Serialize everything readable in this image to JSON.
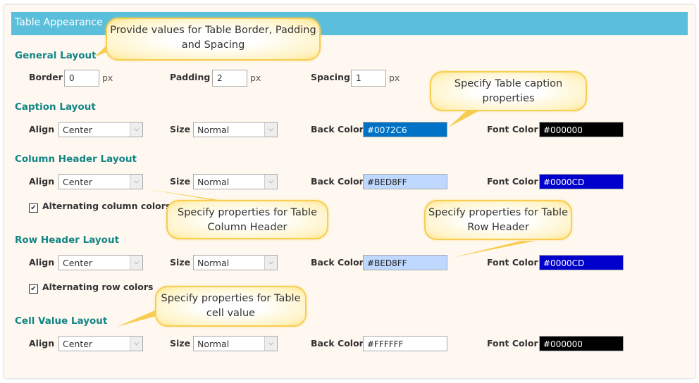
{
  "title": "Table Appearance",
  "general": {
    "heading": "General Layout",
    "border_label": "Border",
    "border_value": "0",
    "padding_label": "Padding",
    "padding_value": "2",
    "spacing_label": "Spacing",
    "spacing_value": "1",
    "unit": "px"
  },
  "labels": {
    "align": "Align",
    "size": "Size",
    "back_color": "Back Color",
    "font_color": "Font Color"
  },
  "caption": {
    "heading": "Caption Layout",
    "align": "Center",
    "size": "Normal",
    "back_color": "#0072C6",
    "font_color": "#000000"
  },
  "column_header": {
    "heading": "Column Header Layout",
    "align": "Center",
    "size": "Normal",
    "back_color": "#BED8FF",
    "font_color": "#0000CD",
    "alternating_label": "Alternating column colors",
    "alternating_checked": true
  },
  "row_header": {
    "heading": "Row Header Layout",
    "align": "Center",
    "size": "Normal",
    "back_color": "#BED8FF",
    "font_color": "#0000CD",
    "alternating_label": "Alternating row colors",
    "alternating_checked": true
  },
  "cell_value": {
    "heading": "Cell Value Layout",
    "align": "Center",
    "size": "Normal",
    "back_color": "#FFFFFF",
    "font_color": "#000000"
  },
  "callouts": {
    "general": "Provide values for Table Border, Padding and Spacing",
    "caption": "Specify Table caption properties",
    "column_header": "Specify properties for Table Column Header",
    "row_header": "Specify properties for Table Row Header",
    "cell_value": "Specify properties for Table cell value"
  },
  "icons": {
    "dropdown": "chevron-down-icon",
    "check": "checkmark-icon"
  },
  "colors": {
    "title_bar": "#5bbfdc",
    "heading": "#138585",
    "panel_bg": "#fef8f0",
    "callout_border": "#f7cd52"
  }
}
